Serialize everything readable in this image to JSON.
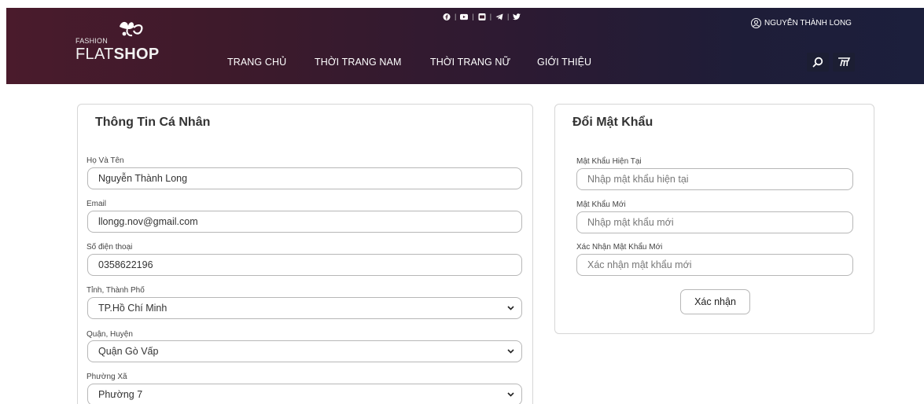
{
  "header": {
    "logo_small": "FASHION",
    "logo_flat": "FLAT",
    "logo_shop": "SHOP",
    "user_name": "NGUYỄN THÀNH LONG",
    "social_icons": [
      "facebook-icon",
      "youtube-icon",
      "instagram-icon",
      "telegram-icon",
      "twitter-icon"
    ],
    "nav": [
      {
        "label": "TRANG CHỦ"
      },
      {
        "label": "THỜI TRANG NAM"
      },
      {
        "label": "THỜI TRANG NỮ"
      },
      {
        "label": "GIỚI THIỆU"
      }
    ]
  },
  "personal": {
    "title": "Thông Tin Cá Nhân",
    "name_label": "Họ Và Tên",
    "name_value": "Nguyễn Thành Long",
    "email_label": "Email",
    "email_value": "llongg.nov@gmail.com",
    "phone_label": "Số điện thoại",
    "phone_value": "0358622196",
    "city_label": "Tỉnh, Thành Phố",
    "city_value": "TP.Hồ Chí Minh",
    "district_label": "Quận, Huyện",
    "district_value": "Quận Gò Vấp",
    "ward_label": "Phường Xã",
    "ward_value": "Phường 7"
  },
  "password": {
    "title": "Đổi Mật Khẩu",
    "current_label": "Mật Khẩu Hiện Tại",
    "current_placeholder": "Nhập mật khẩu hiện tại",
    "new_label": "Mật Khẩu Mới",
    "new_placeholder": "Nhập mật khẩu mới",
    "confirm_label": "Xác Nhận Mật Khẩu Mới",
    "confirm_placeholder": "Xác nhận mật khẩu mới",
    "submit_label": "Xác nhận"
  },
  "colors": {
    "header_left": "#4a1b2c",
    "header_right": "#1c1f3c",
    "icon_button": "#1c1e33",
    "border": "#b7b7b7"
  }
}
